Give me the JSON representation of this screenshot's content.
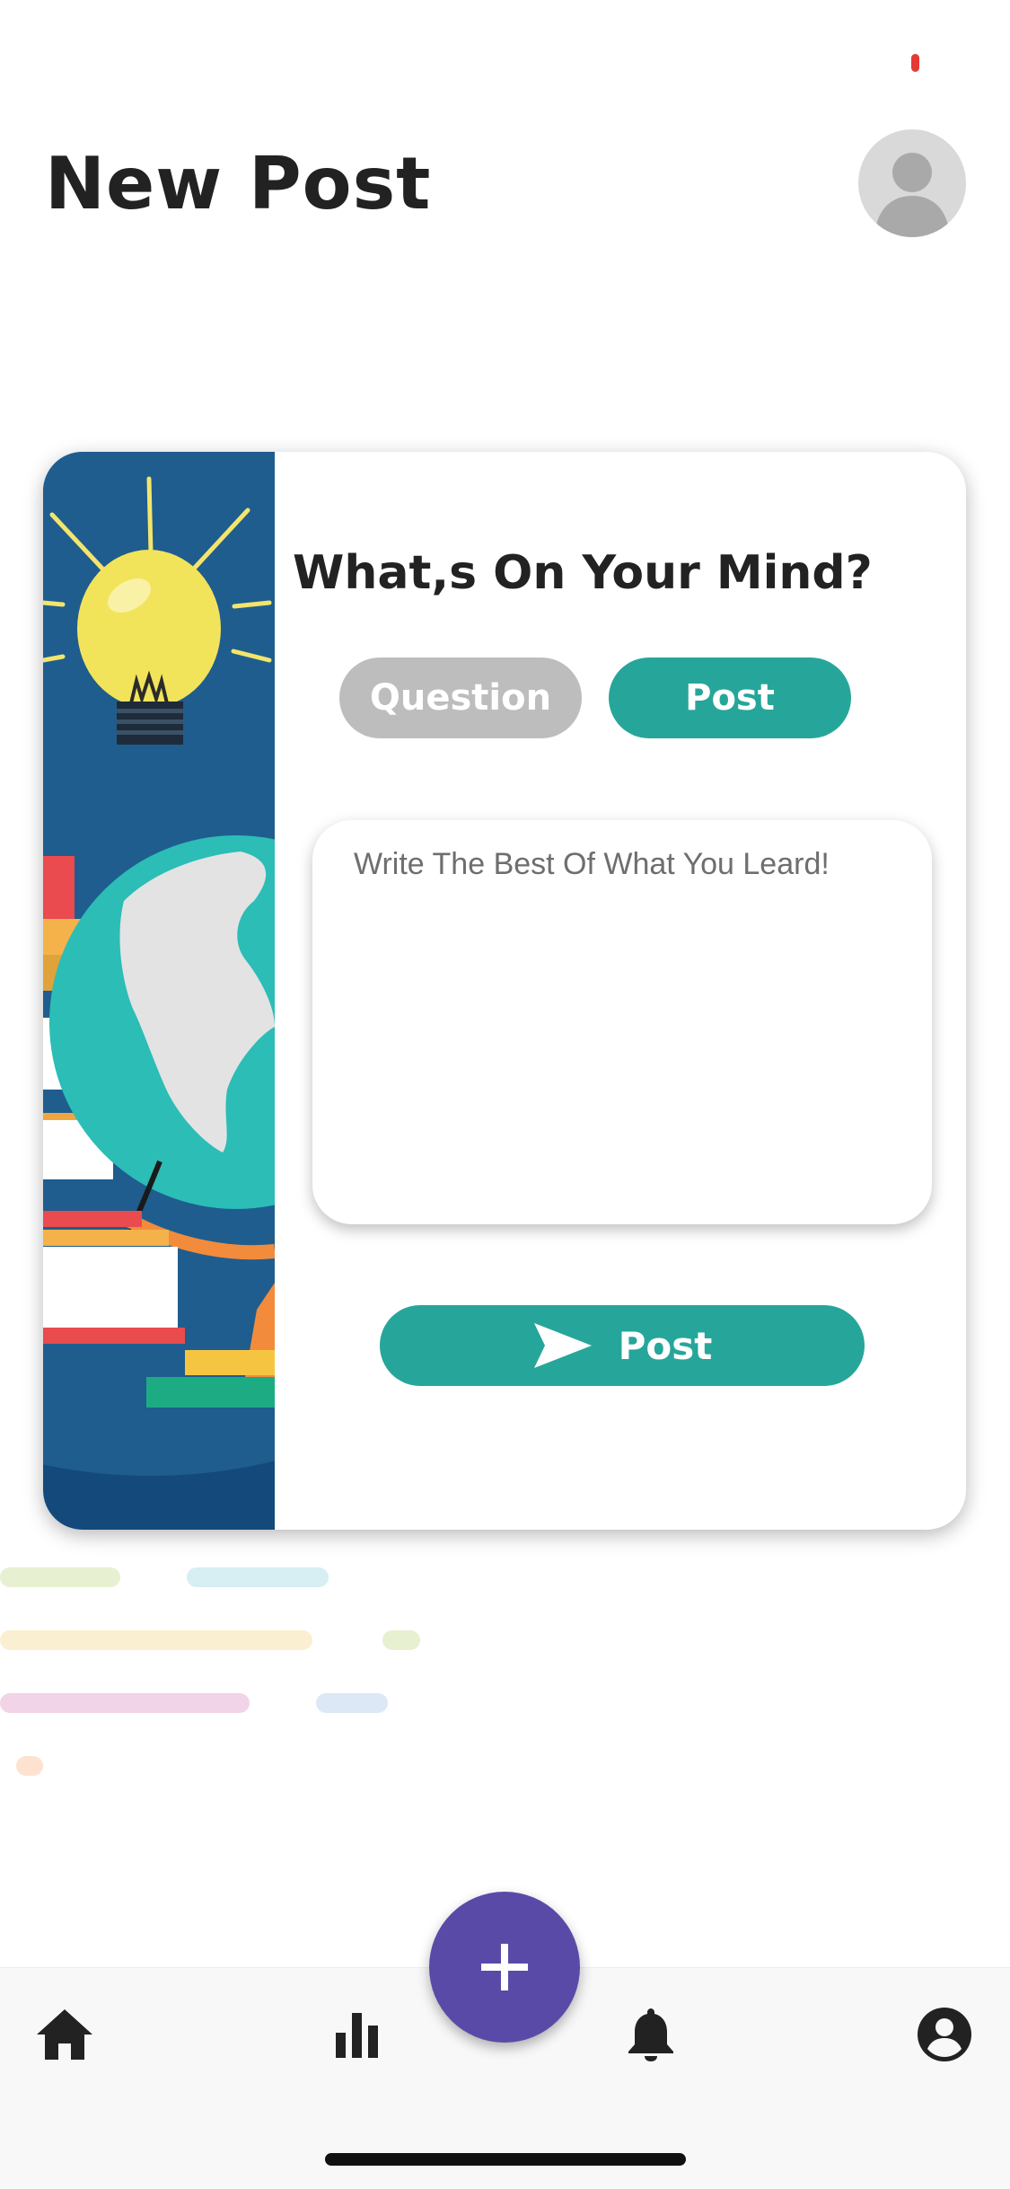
{
  "header": {
    "title": "New Post"
  },
  "card": {
    "heading": "What,s On Your Mind?",
    "toggle": {
      "question_label": "Question",
      "post_label": "Post",
      "selected": "Post"
    },
    "input": {
      "placeholder": "Write The Best Of What You Leard!",
      "value": ""
    },
    "submit_label": "Post",
    "submit_icon": "send-icon",
    "illustration": "lightbulb-globe-books-illustration"
  },
  "bottom_nav": {
    "items": [
      "home-icon",
      "bar-chart-icon",
      "add-icon",
      "bell-icon",
      "account-icon"
    ]
  },
  "colors": {
    "accent": "#26a69a",
    "inactive": "#bdbdbd",
    "fab": "#5a4aa8",
    "title": "#222222"
  }
}
